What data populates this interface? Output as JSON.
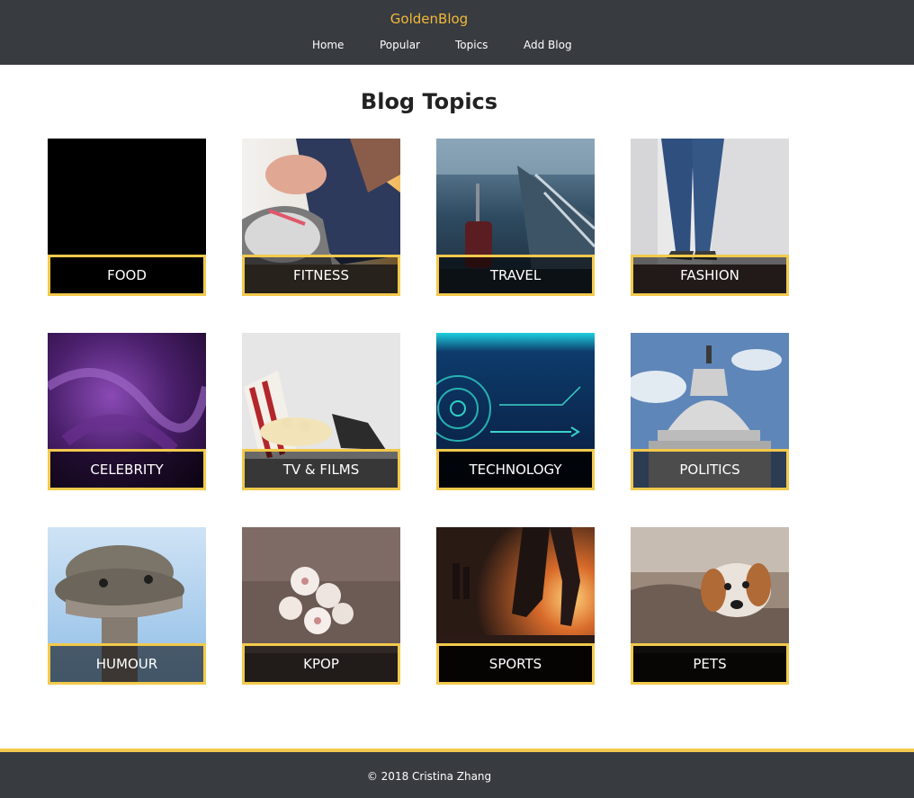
{
  "header": {
    "brand": "GoldenBlog",
    "nav": [
      "Home",
      "Popular",
      "Topics",
      "Add Blog"
    ]
  },
  "main": {
    "title": "Blog Topics",
    "topics": [
      {
        "label": "FOOD"
      },
      {
        "label": "FITNESS"
      },
      {
        "label": "TRAVEL"
      },
      {
        "label": "FASHION"
      },
      {
        "label": "CELEBRITY"
      },
      {
        "label": "TV & FILMS"
      },
      {
        "label": "TECHNOLOGY"
      },
      {
        "label": "POLITICS"
      },
      {
        "label": "HUMOUR"
      },
      {
        "label": "KPOP"
      },
      {
        "label": "SPORTS"
      },
      {
        "label": "PETS"
      }
    ]
  },
  "footer": {
    "text": "© 2018 Cristina Zhang"
  },
  "colors": {
    "header_bg": "#383b40",
    "brand": "#f2b93a",
    "accent_border": "#f2c94c"
  }
}
